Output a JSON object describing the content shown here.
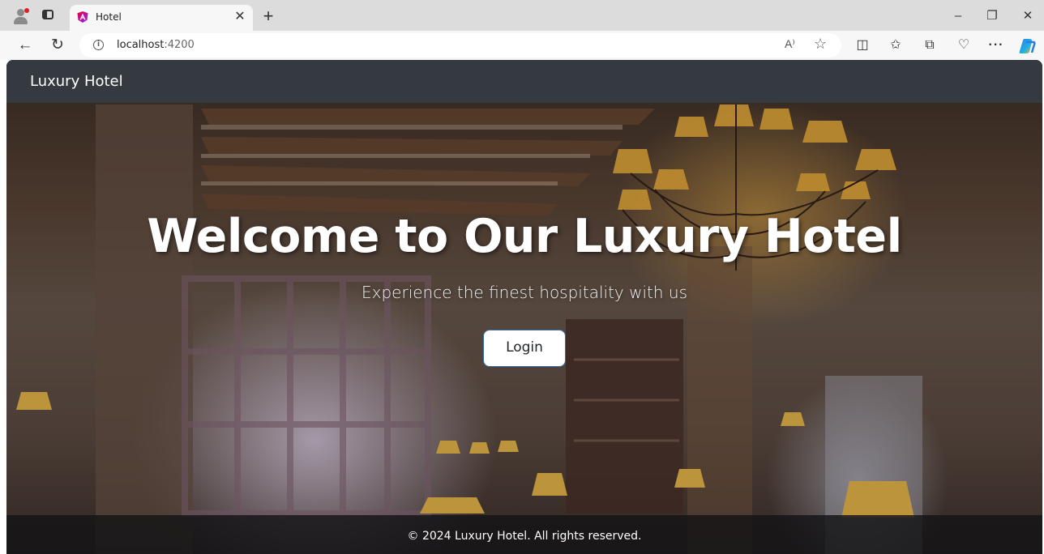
{
  "browser": {
    "tab": {
      "title": "Hotel",
      "close_glyph": "✕",
      "favicon": "angular-icon"
    },
    "new_tab_glyph": "+",
    "window": {
      "minimize": "–",
      "restore": "❐",
      "close": "✕"
    },
    "nav": {
      "back": "←",
      "reload": "↻"
    },
    "address": {
      "host": "localhost",
      "port": ":4200"
    },
    "toolbar": {
      "read_aloud": "A⁾",
      "favorite": "☆",
      "split_screen": "◫",
      "favorites": "✩",
      "collections": "⧉",
      "browser_essentials": "♡",
      "more": "···",
      "copilot": "copilot-icon"
    }
  },
  "page": {
    "brand": "Luxury Hotel",
    "hero": {
      "title": "Welcome to Our Luxury Hotel",
      "subtitle": "Experience the finest hospitality with us",
      "login_label": "Login"
    },
    "footer": {
      "text": "© 2024 Luxury Hotel. All rights reserved."
    }
  },
  "colors": {
    "navbar": "#343a40",
    "footer": "#141416",
    "login_border": "#3b6ea5",
    "tabstrip": "#dcdcdc"
  }
}
